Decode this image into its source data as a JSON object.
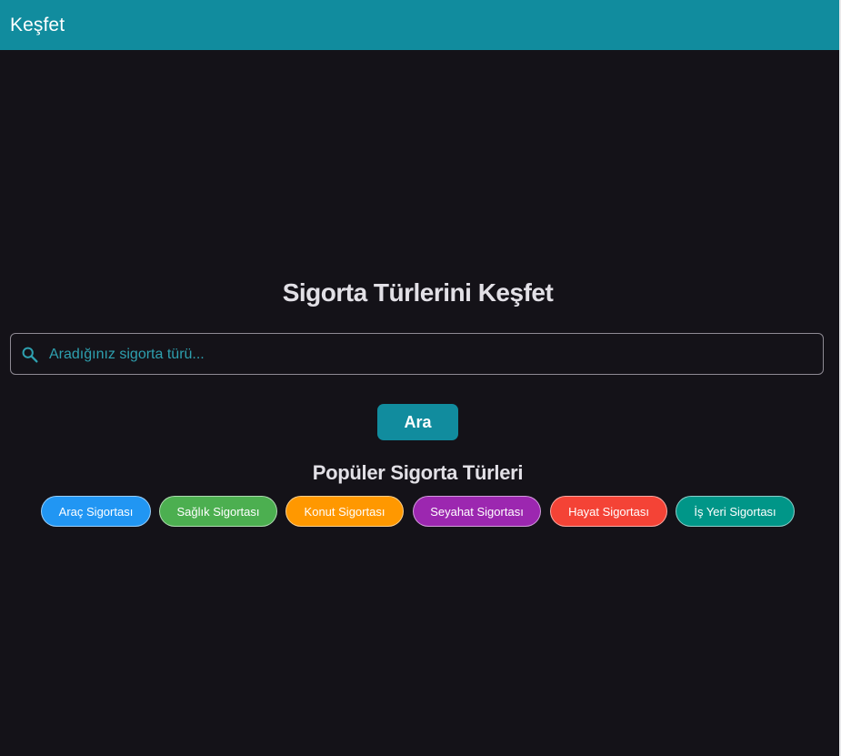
{
  "appbar": {
    "title": "Keşfet",
    "color": "#118C9E"
  },
  "main": {
    "title": "Sigorta Türlerini Keşfet",
    "search": {
      "placeholder": "Aradığınız sigorta türü...",
      "value": "",
      "icon": "search-icon"
    },
    "search_button_label": "Ara",
    "popular_title": "Popüler Sigorta Türleri",
    "chips": [
      {
        "label": "Araç Sigortası",
        "color": "#2196F3"
      },
      {
        "label": "Sağlık Sigortası",
        "color": "#4CAF50"
      },
      {
        "label": "Konut Sigortası",
        "color": "#FF9800"
      },
      {
        "label": "Seyahat Sigortası",
        "color": "#9C27B0"
      },
      {
        "label": "Hayat Sigortası",
        "color": "#F44336"
      },
      {
        "label": "İş Yeri Sigortası",
        "color": "#009688"
      }
    ]
  },
  "colors": {
    "background": "#141218",
    "accent": "#118C9E"
  }
}
